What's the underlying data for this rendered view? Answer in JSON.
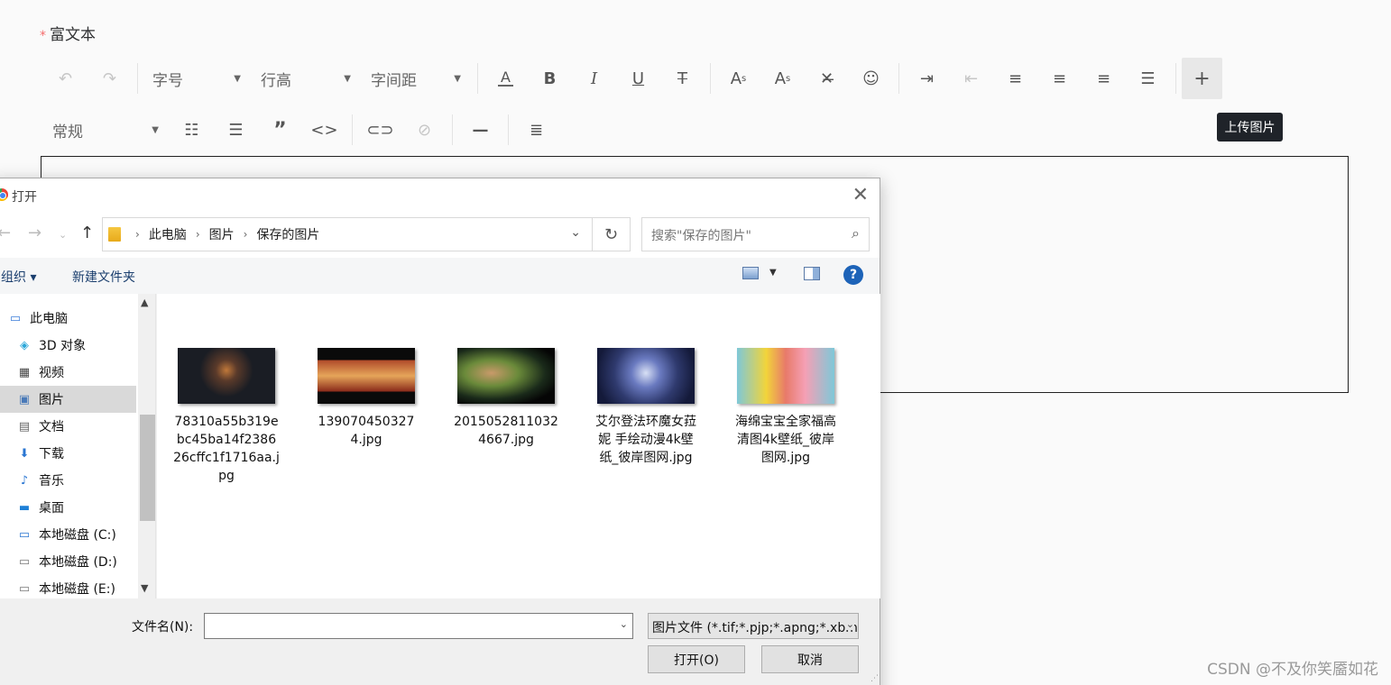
{
  "form": {
    "required_mark": "*",
    "label": "富文本"
  },
  "toolbar1": {
    "undo_icon": "undo-icon",
    "redo_icon": "redo-icon",
    "font_size": "字号",
    "line_height": "行高",
    "letter_spacing": "字间距",
    "buttons": [
      "font-color-icon",
      "bold-icon",
      "italic-icon",
      "underline-icon",
      "strikethrough-icon",
      "superscript-icon",
      "subscript-icon",
      "clear-format-icon",
      "emoji-icon",
      "indent-icon",
      "outdent-icon",
      "align-left-icon",
      "align-center-icon",
      "align-right-icon",
      "justify-icon",
      "upload-image-icon"
    ]
  },
  "toolbar2": {
    "heading": "常规",
    "buttons": [
      "bullet-list-icon",
      "numbered-list-icon",
      "quote-icon",
      "code-icon",
      "link-icon",
      "unlink-icon",
      "horizontal-rule-icon",
      "clear-style-icon"
    ]
  },
  "tooltip": "上传图片",
  "watermark": "CSDN @不及你笑靥如花",
  "dialog": {
    "title": "打开",
    "breadcrumbs": [
      "此电脑",
      "图片",
      "保存的图片"
    ],
    "search_placeholder": "搜索\"保存的图片\"",
    "organize": "组织 ▾",
    "new_folder": "新建文件夹",
    "help": "?",
    "nav_items": [
      {
        "label": "此电脑",
        "icon": "computer-icon"
      },
      {
        "label": "3D 对象",
        "icon": "cube-icon"
      },
      {
        "label": "视频",
        "icon": "video-icon"
      },
      {
        "label": "图片",
        "icon": "pictures-icon"
      },
      {
        "label": "文档",
        "icon": "document-icon"
      },
      {
        "label": "下载",
        "icon": "download-icon"
      },
      {
        "label": "音乐",
        "icon": "music-icon"
      },
      {
        "label": "桌面",
        "icon": "desktop-icon"
      },
      {
        "label": "本地磁盘 (C:)",
        "icon": "drive-icon"
      },
      {
        "label": "本地磁盘 (D:)",
        "icon": "drive-icon"
      },
      {
        "label": "本地磁盘 (E:)",
        "icon": "drive-icon"
      }
    ],
    "files": [
      {
        "name": "78310a55b319ebc45ba14f238626cffc1f1716aa.jpg",
        "thumb_color": "#1a1d24"
      },
      {
        "name": "1390704503274.jpg",
        "thumb_color": "#3a1a12"
      },
      {
        "name": "20150528110324667.jpg",
        "thumb_color": "#1f3a1f"
      },
      {
        "name": "艾尔登法环魔女菈妮 手绘动漫4k壁纸_彼岸图网.jpg",
        "thumb_color": "#2f3a6e"
      },
      {
        "name": "海绵宝宝全家福高清图4k壁纸_彼岸图网.jpg",
        "thumb_color": "#8fd4e6"
      }
    ],
    "filename_label": "文件名(N):",
    "filename_value": "",
    "filter": "图片文件 (*.tif;*.pjp;*.apng;*.xbm;*.jxl;*.svgz;*.jpg;*.jpeg;*.ico;*.tiff;*.gif;*.svg;*.jfif;*.webp;*.png;*.bmp;*.pjpeg;*.avif)",
    "open_button": "打开(O)",
    "cancel_button": "取消"
  }
}
